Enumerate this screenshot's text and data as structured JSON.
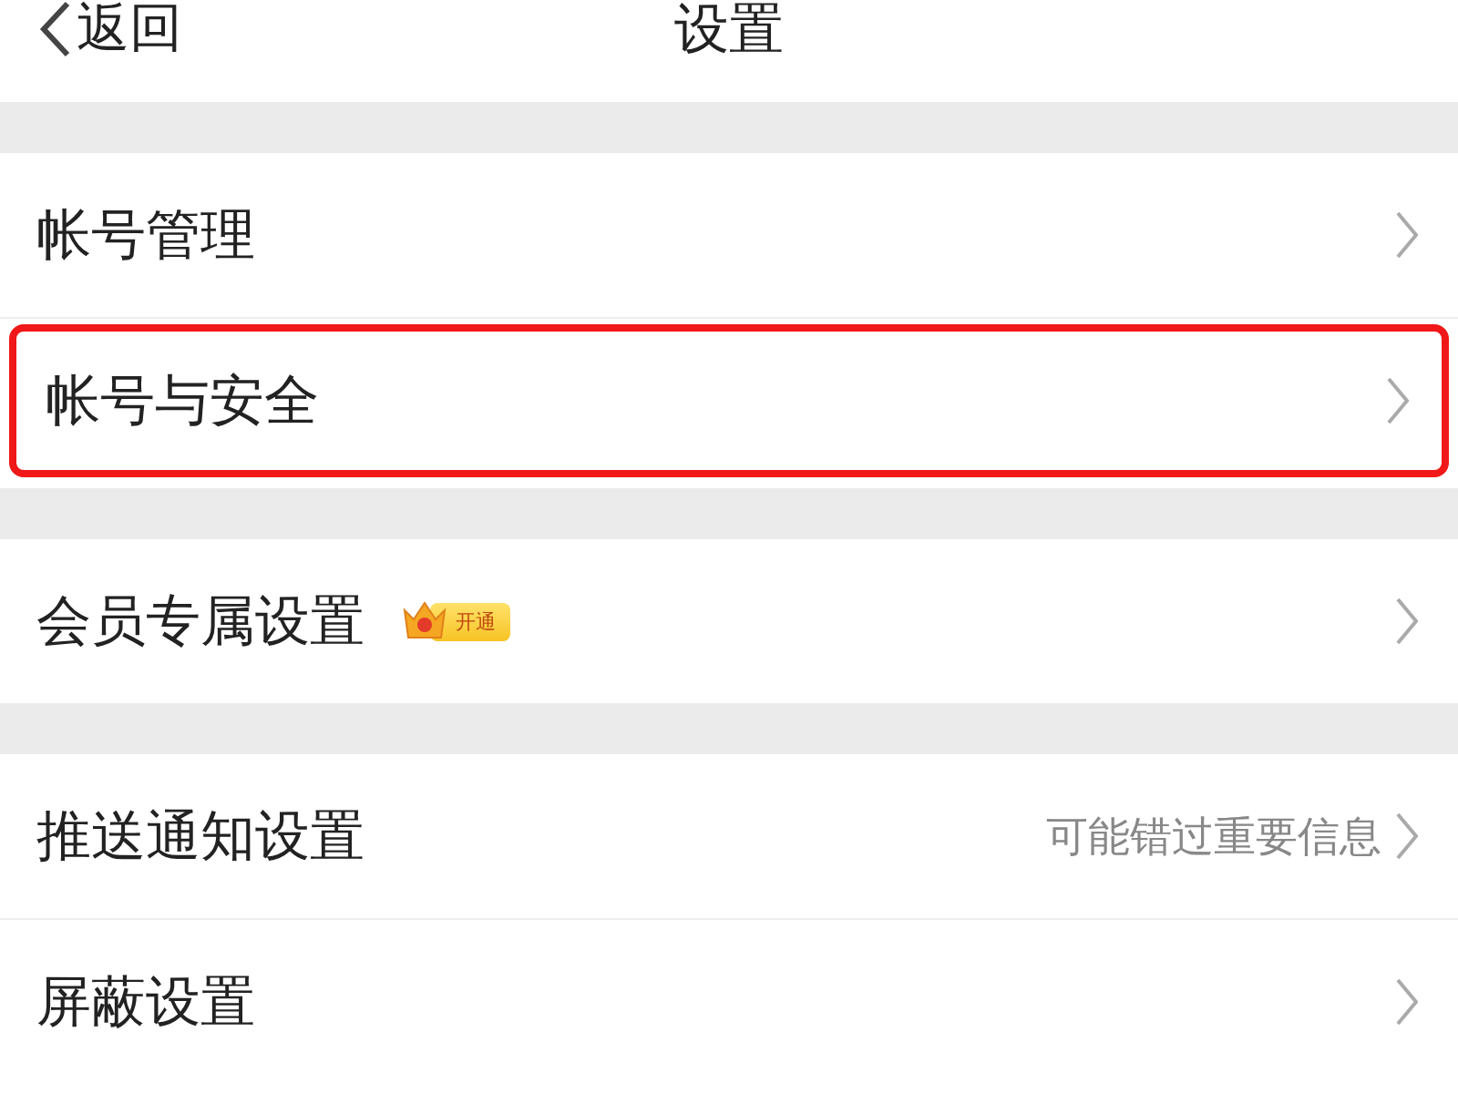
{
  "header": {
    "back": "返回",
    "title": "设置"
  },
  "groups": [
    {
      "rows": [
        {
          "label": "帐号管理",
          "highlighted": false
        },
        {
          "label": "帐号与安全",
          "highlighted": true
        }
      ]
    },
    {
      "rows": [
        {
          "label": "会员专属设置",
          "badge": "开通",
          "highlighted": false
        }
      ]
    },
    {
      "rows": [
        {
          "label": "推送通知设置",
          "detail": "可能错过重要信息",
          "highlighted": false
        },
        {
          "label": "屏蔽设置",
          "highlighted": false
        }
      ]
    }
  ]
}
